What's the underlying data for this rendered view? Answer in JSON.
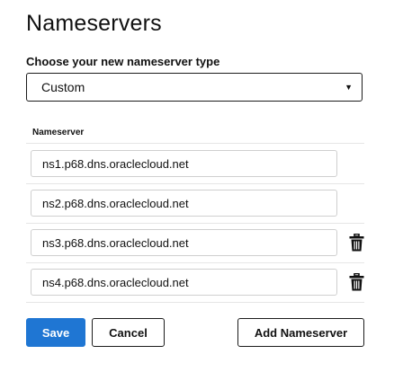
{
  "dialog": {
    "title": "Nameservers",
    "type_label": "Choose your new nameserver type",
    "type_select": {
      "value": "Custom"
    }
  },
  "table": {
    "header": "Nameserver",
    "rows": [
      {
        "value": "ns1.p68.dns.oraclecloud.net",
        "deletable": false
      },
      {
        "value": "ns2.p68.dns.oraclecloud.net",
        "deletable": false
      },
      {
        "value": "ns3.p68.dns.oraclecloud.net",
        "deletable": true,
        "icon": "trash-icon"
      },
      {
        "value": "ns4.p68.dns.oraclecloud.net",
        "deletable": true,
        "icon": "trash-icon"
      }
    ]
  },
  "buttons": {
    "save": "Save",
    "cancel": "Cancel",
    "add": "Add Nameserver"
  },
  "colors": {
    "primary": "#1f76d3",
    "border_dark": "#1c1c1c",
    "input_border": "#cfcfcf",
    "divider": "#e6e6e6"
  }
}
